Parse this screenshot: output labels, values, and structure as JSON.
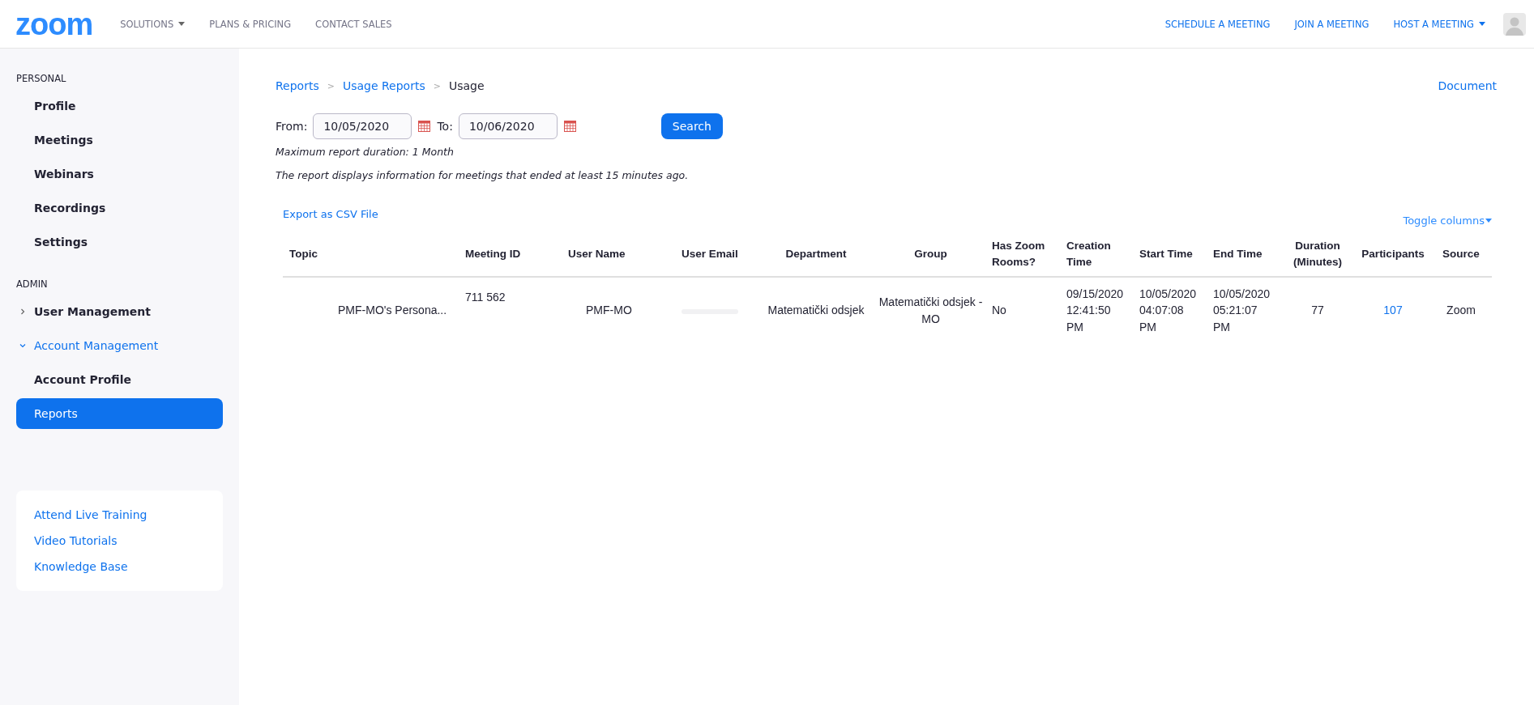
{
  "header": {
    "logo": "zoom",
    "nav": [
      {
        "label": "SOLUTIONS",
        "dropdown": true
      },
      {
        "label": "PLANS & PRICING",
        "dropdown": false
      },
      {
        "label": "CONTACT SALES",
        "dropdown": false
      }
    ],
    "actions": [
      {
        "label": "SCHEDULE A MEETING",
        "dropdown": false
      },
      {
        "label": "JOIN A MEETING",
        "dropdown": false
      },
      {
        "label": "HOST A MEETING",
        "dropdown": true
      }
    ]
  },
  "sidebar": {
    "sections": [
      {
        "title": "PERSONAL",
        "items": [
          {
            "label": "Profile",
            "kind": "item",
            "selected": false
          },
          {
            "label": "Meetings",
            "kind": "item",
            "selected": false
          },
          {
            "label": "Webinars",
            "kind": "item",
            "selected": false
          },
          {
            "label": "Recordings",
            "kind": "item",
            "selected": false
          },
          {
            "label": "Settings",
            "kind": "item",
            "selected": false
          }
        ]
      },
      {
        "title": "ADMIN",
        "items": [
          {
            "label": "User Management",
            "kind": "group",
            "expanded": false,
            "selected": false
          },
          {
            "label": "Account Management",
            "kind": "group",
            "expanded": true,
            "selected": false
          },
          {
            "label": "Account Profile",
            "kind": "item",
            "selected": false
          },
          {
            "label": "Reports",
            "kind": "item",
            "selected": true
          }
        ]
      }
    ],
    "help_links": [
      "Attend Live Training",
      "Video Tutorials",
      "Knowledge Base"
    ]
  },
  "breadcrumb_separator": ">",
  "breadcrumb": [
    {
      "label": "Reports",
      "link": true
    },
    {
      "label": "Usage Reports",
      "link": true
    },
    {
      "label": "Usage",
      "link": false
    }
  ],
  "document_link": "Document",
  "form": {
    "from_label": "From:",
    "from_value": "10/05/2020",
    "to_label": "To:",
    "to_value": "10/06/2020",
    "search_button": "Search",
    "notes": [
      "Maximum report duration: 1 Month",
      "The report displays information for meetings that ended at least 15 minutes ago."
    ]
  },
  "export_link": "Export as CSV File",
  "toggle_columns": "Toggle columns",
  "table": {
    "columns": [
      "Topic",
      "Meeting ID",
      "User Name",
      "User Email",
      "Department",
      "Group",
      "Has Zoom Rooms?",
      "Creation Time",
      "Start Time",
      "End Time",
      "Duration (Minutes)",
      "Participants",
      "Source"
    ],
    "rows": [
      {
        "cells": [
          {
            "kind": "text",
            "text": "PMF-MO's Persona..."
          },
          {
            "kind": "text",
            "text": "711 562"
          },
          {
            "kind": "text",
            "text": "PMF-MO"
          },
          {
            "kind": "redacted"
          },
          {
            "kind": "text",
            "text": "Matematički odsjek"
          },
          {
            "kind": "text",
            "text": "Matematički odsjek - MO"
          },
          {
            "kind": "text",
            "text": "No"
          },
          {
            "kind": "text",
            "text": "09/15/2020 12:41:50 PM"
          },
          {
            "kind": "text",
            "text": "10/05/2020 04:07:08 PM"
          },
          {
            "kind": "text",
            "text": "10/05/2020 05:21:07 PM"
          },
          {
            "kind": "text",
            "text": "77"
          },
          {
            "kind": "link",
            "text": "107"
          },
          {
            "kind": "text",
            "text": "Zoom"
          }
        ]
      }
    ]
  }
}
